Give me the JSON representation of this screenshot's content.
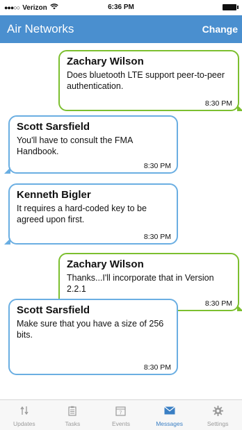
{
  "status_bar": {
    "signal": "●●●○○",
    "carrier": "Verizon",
    "time": "6:36 PM"
  },
  "nav": {
    "title": "Air Networks",
    "change_label": "Change"
  },
  "messages": [
    {
      "direction": "sent",
      "sender": "Zachary Wilson",
      "text": "Does bluetooth LTE support peer-to-peer authentication.",
      "time": "8:30 PM"
    },
    {
      "direction": "received",
      "sender": "Scott Sarsfield",
      "text": "You'll have to consult the FMA Handbook.",
      "time": "8:30 PM"
    },
    {
      "direction": "received",
      "sender": "Kenneth Bigler",
      "text": "It requires a hard-coded key to be agreed upon first.",
      "time": "8:30 PM"
    },
    {
      "direction": "sent",
      "sender": "Zachary Wilson",
      "text": "Thanks...I'll incorporate that in Version 2.2.1",
      "time": "8:30 PM"
    },
    {
      "direction": "received",
      "sender": "Scott Sarsfield",
      "text": "Make sure that you have a size of 256 bits.",
      "time": "8:30 PM"
    }
  ],
  "tabs": [
    {
      "label": "Updates",
      "icon": "updates-icon",
      "active": false
    },
    {
      "label": "Tasks",
      "icon": "tasks-icon",
      "active": false
    },
    {
      "label": "Events",
      "icon": "calendar-icon",
      "active": false
    },
    {
      "label": "Messages",
      "icon": "envelope-icon",
      "active": true
    },
    {
      "label": "Settings",
      "icon": "gear-icon",
      "active": false
    }
  ],
  "colors": {
    "nav_background": "#4a8fcf",
    "sent_border": "#7cbf2f",
    "received_border": "#6aaee2",
    "active_tab": "#3a7fc4",
    "inactive_tab": "#9a9a9a"
  }
}
